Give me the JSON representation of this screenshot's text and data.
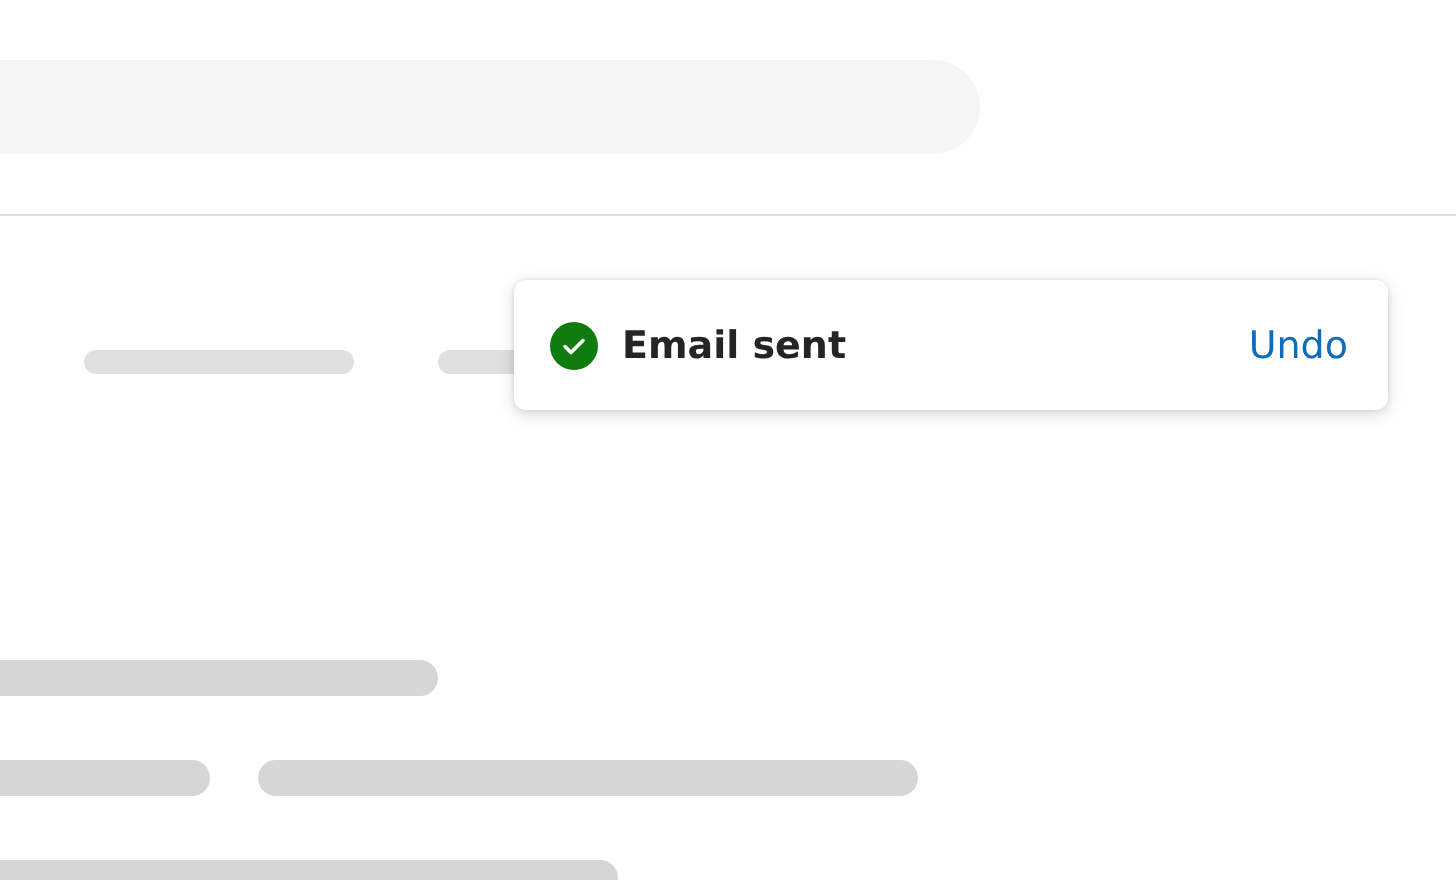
{
  "toast": {
    "kind": "success",
    "message": "Email sent",
    "action": "Undo"
  }
}
